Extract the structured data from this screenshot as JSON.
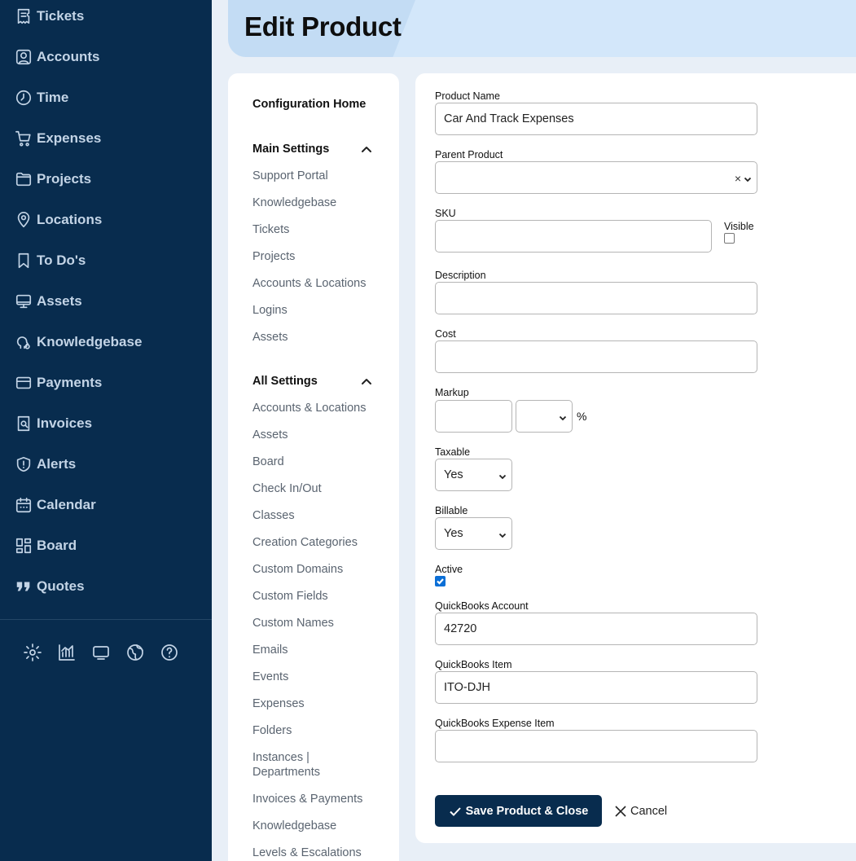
{
  "sidebar": {
    "items": [
      {
        "label": "Tickets",
        "icon": "ticket-icon"
      },
      {
        "label": "Accounts",
        "icon": "account-icon"
      },
      {
        "label": "Time",
        "icon": "clock-icon"
      },
      {
        "label": "Expenses",
        "icon": "cart-icon"
      },
      {
        "label": "Projects",
        "icon": "folder-icon"
      },
      {
        "label": "Locations",
        "icon": "location-pin-icon"
      },
      {
        "label": "To Do's",
        "icon": "bookmark-icon"
      },
      {
        "label": "Assets",
        "icon": "monitor-icon"
      },
      {
        "label": "Knowledgebase",
        "icon": "brain-icon"
      },
      {
        "label": "Payments",
        "icon": "credit-card-icon"
      },
      {
        "label": "Invoices",
        "icon": "invoice-icon"
      },
      {
        "label": "Alerts",
        "icon": "shield-alert-icon"
      },
      {
        "label": "Calendar",
        "icon": "calendar-icon"
      },
      {
        "label": "Board",
        "icon": "board-icon"
      },
      {
        "label": "Quotes",
        "icon": "quote-icon"
      }
    ],
    "bottom_icons": [
      "gear-icon",
      "chart-icon",
      "monitor-icon",
      "globe-icon",
      "help-icon"
    ]
  },
  "header": {
    "title": "Edit Product"
  },
  "settings_nav": {
    "home": "Configuration Home",
    "main_settings": {
      "title": "Main Settings",
      "items": [
        "Support Portal",
        "Knowledgebase",
        "Tickets",
        "Projects",
        "Accounts & Locations",
        "Logins",
        "Assets"
      ]
    },
    "all_settings": {
      "title": "All Settings",
      "items": [
        "Accounts & Locations",
        "Assets",
        "Board",
        "Check In/Out",
        "Classes",
        "Creation Categories",
        "Custom Domains",
        "Custom Fields",
        "Custom Names",
        "Emails",
        "Events",
        "Expenses",
        "Folders",
        "Instances |",
        "Departments",
        "Invoices & Payments",
        "Knowledgebase",
        "Levels & Escalations"
      ]
    }
  },
  "form": {
    "product_name": {
      "label": "Product Name",
      "value": "Car And Track Expenses"
    },
    "parent_product": {
      "label": "Parent Product",
      "value": "",
      "clear": "×"
    },
    "sku": {
      "label": "SKU",
      "value": ""
    },
    "visible": {
      "label": "Visible",
      "checked": false
    },
    "description": {
      "label": "Description",
      "value": ""
    },
    "cost": {
      "label": "Cost",
      "value": ""
    },
    "markup": {
      "label": "Markup",
      "value": "",
      "unit_value": "",
      "suffix": "%"
    },
    "taxable": {
      "label": "Taxable",
      "value": "Yes"
    },
    "billable": {
      "label": "Billable",
      "value": "Yes"
    },
    "active": {
      "label": "Active",
      "checked": true
    },
    "qb_account": {
      "label": "QuickBooks Account",
      "value": "42720"
    },
    "qb_item": {
      "label": "QuickBooks Item",
      "value": "ITO-DJH"
    },
    "qb_expense_item": {
      "label": "QuickBooks Expense Item",
      "value": ""
    },
    "save_label": "Save Product & Close",
    "cancel_label": "Cancel"
  }
}
